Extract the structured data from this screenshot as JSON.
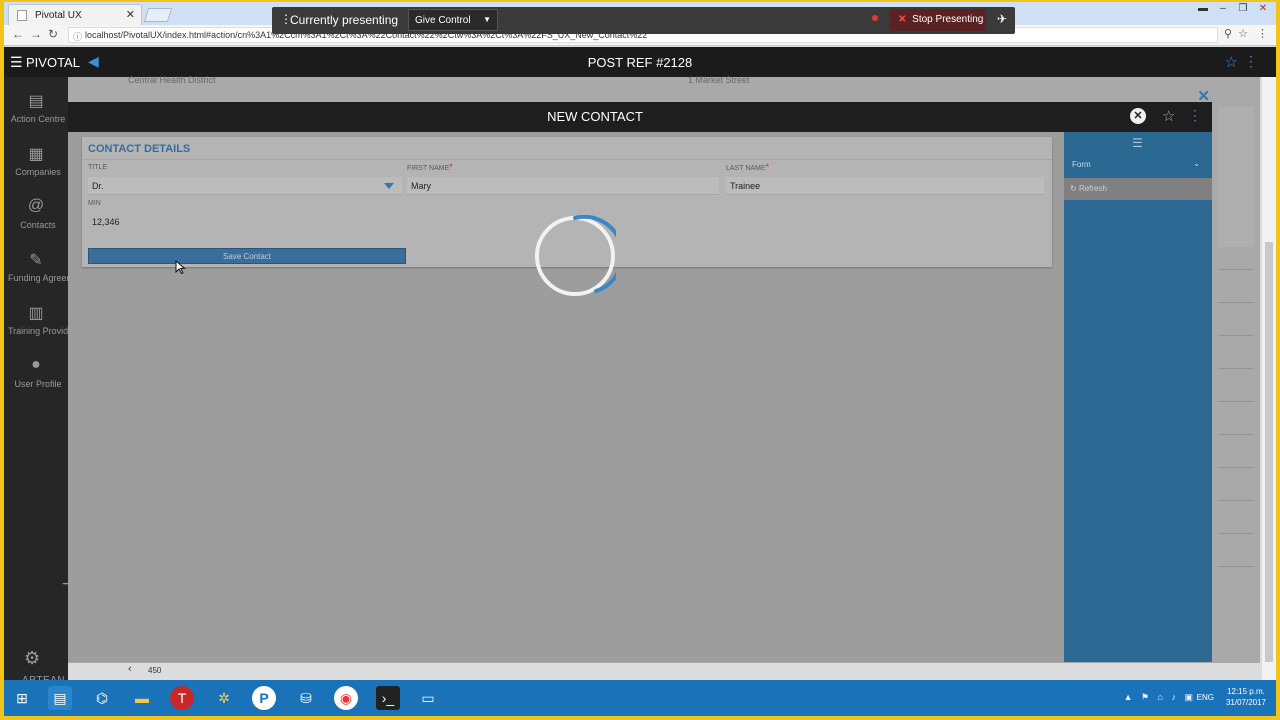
{
  "browser": {
    "tab_title": "Pivotal UX",
    "url": "localhost/PivotalUX/index.html#action/cn%3A1%2Ccm%3A1%2Ct%3A%22Contact%22%2Ctw%3A%2Ct%3A%22FS_UX_New_Contact%22"
  },
  "presenting": {
    "status": "Currently presenting",
    "give_control": "Give Control",
    "stop": "Stop Presenting"
  },
  "app": {
    "brand": "PIVOTAL",
    "page_title": "POST REF #2128",
    "footer_logo": "APTEAN"
  },
  "sidebar": {
    "items": [
      {
        "label": "Action Centre",
        "icon": "action-centre-icon"
      },
      {
        "label": "Companies",
        "icon": "building-icon"
      },
      {
        "label": "Contacts",
        "icon": "contact-icon"
      },
      {
        "label": "Funding Agreements",
        "icon": "funding-icon"
      },
      {
        "label": "Training Providers",
        "icon": "training-icon"
      },
      {
        "label": "User Profile",
        "icon": "user-icon"
      }
    ]
  },
  "background": {
    "text1": "Central Health District",
    "text2": "1 Market Street"
  },
  "modal": {
    "title": "NEW CONTACT",
    "section_title": "CONTACT DETAILS",
    "fields": {
      "title_label": "TITLE",
      "title_value": "Dr.",
      "first_name_label": "FIRST NAME",
      "first_name_value": "Mary",
      "last_name_label": "LAST NAME",
      "last_name_value": "Trainee",
      "min_label": "MIN",
      "min_value": "12,346"
    },
    "required_marker": "*",
    "save_label": "Save Contact"
  },
  "right_panel": {
    "form_label": "Form",
    "refresh_label": "Refresh"
  },
  "statusbar": {
    "count": "450"
  },
  "taskbar": {
    "lang": "ENG",
    "time": "12:15 p.m.",
    "date": "31/07/2017"
  },
  "colors": {
    "accent": "#2f77b4",
    "header_bg": "#1b1b1b",
    "panel_blue": "#2e6993"
  }
}
